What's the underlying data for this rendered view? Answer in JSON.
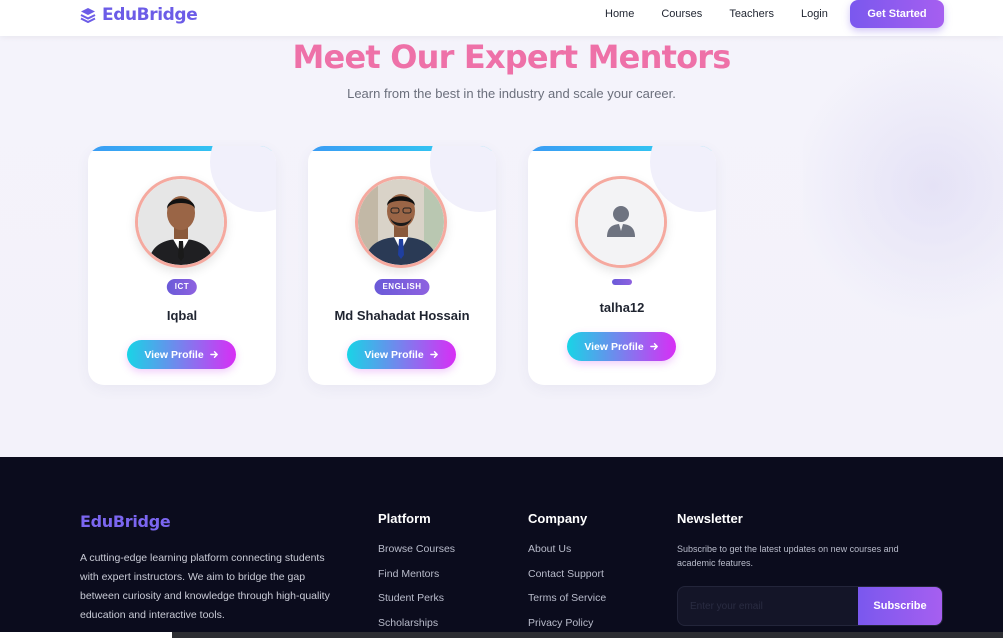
{
  "nav": {
    "brand": "EduBridge",
    "links": [
      "Home",
      "Courses",
      "Teachers",
      "Login"
    ],
    "cta": "Get Started"
  },
  "mentors": {
    "title": "Meet Our Expert Mentors",
    "subtitle": "Learn from the best in the industry and scale your career.",
    "cards": [
      {
        "badge": "ICT",
        "name": "Iqbal",
        "button": "View Profile"
      },
      {
        "badge": "ENGLISH",
        "name": "Md Shahadat Hossain",
        "button": "View Profile"
      },
      {
        "badge": "",
        "name": "talha12",
        "button": "View Profile"
      }
    ]
  },
  "footer": {
    "brand": "EduBridge",
    "description": "A cutting-edge learning platform connecting students with expert instructors. We aim to bridge the gap between curiosity and knowledge through high-quality education and interactive tools.",
    "platform": {
      "title": "Platform",
      "links": [
        "Browse Courses",
        "Find Mentors",
        "Student Perks",
        "Scholarships"
      ]
    },
    "company": {
      "title": "Company",
      "links": [
        "About Us",
        "Contact Support",
        "Terms of Service",
        "Privacy Policy"
      ]
    },
    "newsletter": {
      "title": "Newsletter",
      "text": "Subscribe to get the latest updates on new courses and academic features.",
      "placeholder": "Enter your email",
      "button": "Subscribe"
    }
  },
  "colors": {
    "brand": "#6c5ce7",
    "title_pink": "#ee71a8",
    "footer_bg": "#0b0c1d"
  }
}
